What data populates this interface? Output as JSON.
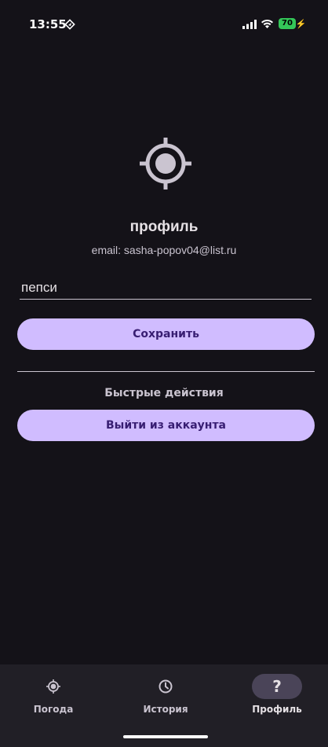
{
  "status_bar": {
    "time": "13:55",
    "battery": "70"
  },
  "profile": {
    "title": "профиль",
    "email": "email: sasha-popov04@list.ru",
    "name_value": "пепси",
    "save_label": "Сохранить",
    "quick_actions_label": "Быстрые действия",
    "logout_label": "Выйти из аккаунта"
  },
  "nav": {
    "items": [
      {
        "label": "Погода",
        "icon": "crosshair-icon"
      },
      {
        "label": "История",
        "icon": "clock-icon"
      },
      {
        "label": "Профиль",
        "icon": "question-icon"
      }
    ],
    "active": "Профиль"
  },
  "colors": {
    "background": "#141218",
    "primary": "#d0bcff",
    "on_primary": "#381e72",
    "nav_bg": "#211f26",
    "active_pill": "#4a4458",
    "battery": "#34c759"
  }
}
